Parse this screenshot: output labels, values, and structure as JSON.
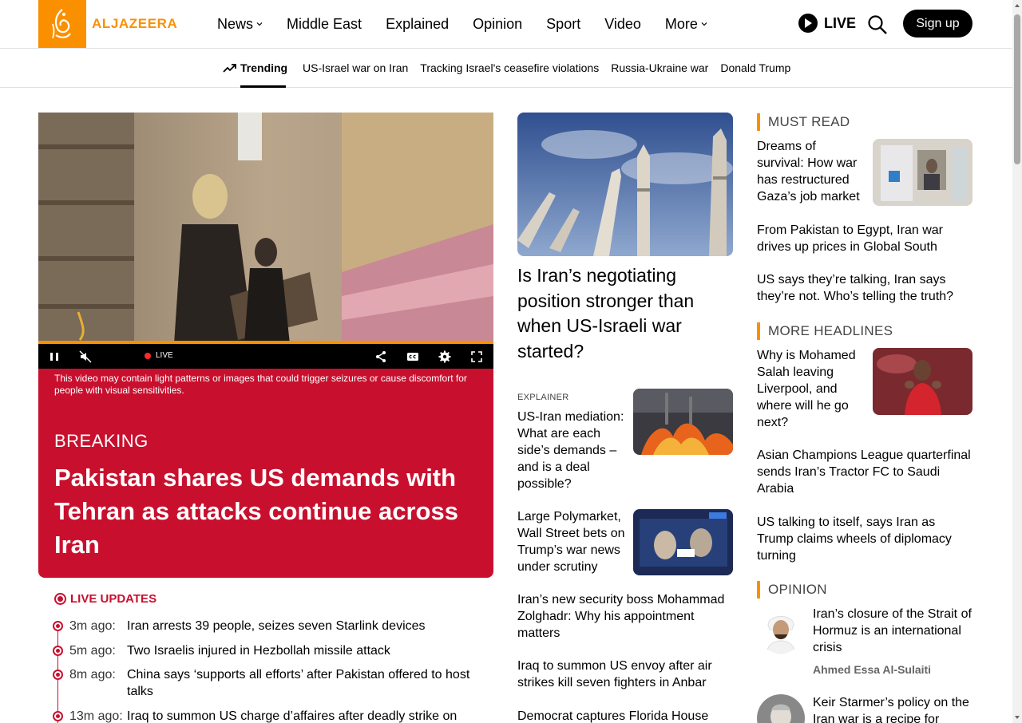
{
  "brand": {
    "name": "ALJAZEERA",
    "color": "#fa9000"
  },
  "nav": {
    "items": [
      {
        "label": "News",
        "dropdown": true
      },
      {
        "label": "Middle East",
        "dropdown": false
      },
      {
        "label": "Explained",
        "dropdown": false
      },
      {
        "label": "Opinion",
        "dropdown": false
      },
      {
        "label": "Sport",
        "dropdown": false
      },
      {
        "label": "Video",
        "dropdown": false
      },
      {
        "label": "More",
        "dropdown": true
      }
    ],
    "live_label": "LIVE",
    "signup_label": "Sign up"
  },
  "trending": {
    "label": "Trending",
    "links": [
      "US-Israel war on Iran",
      "Tracking Israel's ceasefire violations",
      "Russia-Ukraine war",
      "Donald Trump"
    ]
  },
  "video": {
    "live_label": "LIVE",
    "warning": "This video may contain light patterns or images that could trigger seizures or cause discomfort for people with visual sensitivities."
  },
  "breaking": {
    "tag": "BREAKING",
    "title": "Pakistan shares US demands with Tehran as attacks continue across Iran",
    "color": "#c8102e"
  },
  "live_updates": {
    "label": "LIVE UPDATES",
    "items": [
      {
        "time": "3m ago:",
        "text": "Iran arrests 39 people, seizes seven Starlink devices"
      },
      {
        "time": "5m ago:",
        "text": "Two Israelis injured in Hezbollah missile attack"
      },
      {
        "time": "8m ago:",
        "text": "China says ‘supports all efforts’ after Pakistan offered to host talks"
      },
      {
        "time": "13m ago:",
        "text": "Iraq to summon US charge d’affaires after deadly strike on"
      }
    ]
  },
  "middle": {
    "lead_title": "Is Iran’s negotiating position stronger than when US-Israeli war started?",
    "kicker": "EXPLAINER",
    "story1": "US-Iran mediation: What are each side’s demands – and is a deal possible?",
    "story2": "Large Polymarket, Wall Street bets on Trump’s war news under scrutiny",
    "story3": "Iran’s new security boss Mohammad Zolghadr: Why his appointment matters",
    "story4": "Iraq to summon US envoy after air strikes kill seven fighters in Anbar",
    "story5": "Democrat captures Florida House"
  },
  "right": {
    "must_read": {
      "label": "MUST READ",
      "items": [
        "Dreams of survival: How war has restructured Gaza’s job market",
        "From Pakistan to Egypt, Iran war drives up prices in Global South",
        "US says they’re talking, Iran says they’re not. Who’s telling the truth?"
      ]
    },
    "more_headlines": {
      "label": "MORE HEADLINES",
      "items": [
        "Why is Mohamed Salah leaving Liverpool, and where will he go next?",
        "Asian Champions League quarterfinal sends Iran’s Tractor FC to Saudi Arabia",
        "US talking to itself, says Iran as Trump claims wheels of diplomacy turning"
      ]
    },
    "opinion": {
      "label": "OPINION",
      "items": [
        {
          "title": "Iran’s closure of the Strait of Hormuz is an international crisis",
          "author": "Ahmed Essa Al-Sulaiti"
        },
        {
          "title": "Keir Starmer’s policy on the Iran war is a recipe for",
          "author": ""
        }
      ]
    }
  }
}
